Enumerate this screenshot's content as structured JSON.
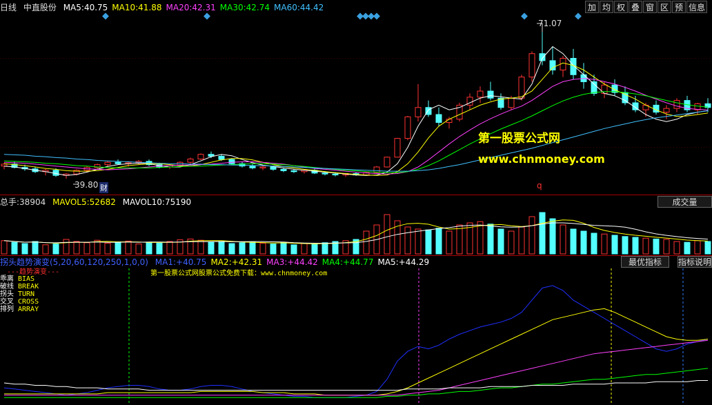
{
  "header": {
    "period": "日线",
    "stock": "中直股份",
    "ma": [
      {
        "label": "MA5:",
        "value": "40.75",
        "color": "#ffffff"
      },
      {
        "label": "MA10:",
        "value": "41.88",
        "color": "#ffff00"
      },
      {
        "label": "MA20:",
        "value": "42.31",
        "color": "#ff40ff"
      },
      {
        "label": "MA30:",
        "value": "42.74",
        "color": "#00ff00"
      },
      {
        "label": "MA60:",
        "value": "44.42",
        "color": "#40c0ff"
      }
    ]
  },
  "toolbar": [
    "加",
    "均",
    "权",
    "叠",
    "窗",
    "区",
    "预",
    "信息"
  ],
  "annotations": {
    "high": "71.07",
    "low": "39.80",
    "cai": "财",
    "q": "q"
  },
  "watermark": {
    "line1": "第一股票公式网",
    "line2": "www.chnmoney.com"
  },
  "volume_header": {
    "total_label": "总手:",
    "total_value": "38904",
    "mavol5_label": "MAVOL5:",
    "mavol5_value": "52682",
    "mavol10_label": "MAVOL10:",
    "mavol10_value": "75190",
    "button": "成交量"
  },
  "indicator_header": {
    "name": "拐头趋势演变(5,20,60,120,250,1,0,0)",
    "items": [
      {
        "label": "MA1:",
        "value": "+40.75",
        "color": "#4060ff"
      },
      {
        "label": "MA2:",
        "value": "+42.31",
        "color": "#ffff00"
      },
      {
        "label": "MA3:",
        "value": "+44.42",
        "color": "#ff40ff"
      },
      {
        "label": "MA4:",
        "value": "+44.77",
        "color": "#00ff00"
      },
      {
        "label": "MA5:",
        "value": "+44.29",
        "color": "#ffffff"
      }
    ],
    "btn_best": "最优指标",
    "btn_help": "指标说明"
  },
  "indicator_legend": {
    "title": "---趋势演变---",
    "rows": [
      {
        "cn": "乖离",
        "en": "BIAS"
      },
      {
        "cn": "破线",
        "en": "BREAK"
      },
      {
        "cn": "拐头",
        "en": "TURN"
      },
      {
        "cn": "交叉",
        "en": "CROSS"
      },
      {
        "cn": "排列",
        "en": "ARRAY"
      }
    ],
    "note": "第一股票公式网股票公式免费下载：www.chnmoney.com"
  },
  "chart_data": {
    "type": "line",
    "price": {
      "ylim": [
        37,
        75
      ],
      "ma5": [
        42.5,
        42.3,
        42.0,
        41.6,
        41.3,
        40.9,
        40.5,
        40.7,
        41.2,
        41.8,
        42.4,
        42.8,
        43.0,
        43.1,
        43.0,
        42.6,
        42.3,
        42.3,
        42.8,
        43.6,
        44.5,
        45.0,
        44.7,
        43.9,
        43.2,
        42.7,
        42.4,
        42.1,
        41.8,
        41.6,
        41.4,
        41.2,
        41.0,
        40.8,
        40.6,
        40.5,
        40.6,
        41.2,
        43.0,
        46.5,
        51.0,
        54.5,
        55.5,
        54.5,
        55.0,
        56.0,
        57.0,
        57.5,
        57.3,
        57.0,
        56.8,
        60.0,
        65.5,
        68.0,
        66.5,
        64.0,
        62.0,
        60.0,
        58.0,
        57.5,
        56.5,
        55.0,
        53.5,
        52.5,
        52.0,
        52.5,
        53.5,
        54.0,
        54.3
      ],
      "ma10": [
        43.0,
        42.8,
        42.6,
        42.3,
        42.0,
        41.8,
        41.5,
        41.4,
        41.4,
        41.5,
        41.8,
        42.2,
        42.6,
        42.8,
        43.0,
        43.0,
        42.8,
        42.6,
        42.5,
        42.8,
        43.3,
        43.8,
        44.1,
        44.1,
        43.8,
        43.3,
        42.8,
        42.4,
        42.1,
        41.8,
        41.6,
        41.3,
        41.1,
        40.9,
        40.7,
        40.6,
        40.5,
        40.6,
        41.3,
        43.0,
        45.5,
        48.5,
        51.0,
        52.5,
        53.5,
        54.5,
        55.5,
        56.2,
        56.8,
        57.0,
        57.3,
        58.5,
        61.0,
        63.5,
        64.5,
        64.0,
        63.0,
        61.5,
        60.0,
        58.8,
        57.8,
        56.8,
        55.5,
        54.5,
        53.6,
        53.1,
        53.2,
        53.5,
        53.8
      ],
      "ma20": [
        43.3,
        43.2,
        43.1,
        42.9,
        42.7,
        42.5,
        42.3,
        42.1,
        41.9,
        41.8,
        41.7,
        41.8,
        41.9,
        42.1,
        42.3,
        42.5,
        42.6,
        42.7,
        42.7,
        42.8,
        42.9,
        43.1,
        43.3,
        43.4,
        43.4,
        43.3,
        43.1,
        42.9,
        42.6,
        42.3,
        42.0,
        41.8,
        41.6,
        41.4,
        41.2,
        41.0,
        40.9,
        40.8,
        40.9,
        41.3,
        42.3,
        43.8,
        45.5,
        47.2,
        48.8,
        50.2,
        51.5,
        52.6,
        53.6,
        54.5,
        55.3,
        56.5,
        58.0,
        59.5,
        60.5,
        61.0,
        61.2,
        61.0,
        60.5,
        60.0,
        59.3,
        58.5,
        57.6,
        56.8,
        56.0,
        55.3,
        54.8,
        54.6,
        54.5
      ],
      "ma30": [
        43.6,
        43.5,
        43.4,
        43.3,
        43.1,
        43.0,
        42.8,
        42.6,
        42.5,
        42.3,
        42.2,
        42.1,
        42.1,
        42.1,
        42.1,
        42.2,
        42.3,
        42.4,
        42.5,
        42.5,
        42.6,
        42.7,
        42.8,
        42.9,
        43.0,
        43.0,
        42.9,
        42.8,
        42.6,
        42.4,
        42.2,
        42.0,
        41.8,
        41.6,
        41.5,
        41.3,
        41.2,
        41.1,
        41.1,
        41.3,
        41.8,
        42.6,
        43.6,
        44.8,
        46.0,
        47.2,
        48.3,
        49.4,
        50.4,
        51.3,
        52.2,
        53.2,
        54.3,
        55.4,
        56.4,
        57.2,
        57.8,
        58.2,
        58.4,
        58.4,
        58.2,
        57.9,
        57.5,
        57.0,
        56.5,
        56.0,
        55.6,
        55.3,
        55.1
      ],
      "ma60": [
        45.0,
        44.9,
        44.8,
        44.6,
        44.5,
        44.3,
        44.2,
        44.0,
        43.9,
        43.7,
        43.6,
        43.5,
        43.4,
        43.3,
        43.2,
        43.1,
        43.0,
        43.0,
        42.9,
        42.9,
        42.8,
        42.8,
        42.7,
        42.7,
        42.6,
        42.6,
        42.5,
        42.4,
        42.3,
        42.2,
        42.1,
        42.0,
        41.9,
        41.8,
        41.7,
        41.6,
        41.5,
        41.4,
        41.4,
        41.4,
        41.5,
        41.7,
        42.0,
        42.4,
        42.8,
        43.3,
        43.8,
        44.3,
        44.8,
        45.3,
        45.8,
        46.3,
        46.9,
        47.5,
        48.1,
        48.7,
        49.3,
        49.9,
        50.5,
        51.0,
        51.5,
        52.0,
        52.4,
        52.8,
        53.1,
        53.4,
        53.7,
        54.0,
        54.3
      ]
    },
    "candles": [
      [
        42.5,
        43.2,
        41.8,
        42.9
      ],
      [
        42.9,
        43.5,
        42.0,
        42.2
      ],
      [
        42.2,
        42.8,
        41.5,
        41.9
      ],
      [
        41.9,
        42.4,
        41.0,
        41.3
      ],
      [
        41.3,
        41.9,
        40.5,
        41.6
      ],
      [
        41.6,
        42.0,
        40.2,
        40.5
      ],
      [
        40.5,
        41.0,
        39.8,
        40.8
      ],
      [
        40.8,
        41.8,
        40.5,
        41.6
      ],
      [
        41.6,
        42.5,
        41.2,
        42.2
      ],
      [
        42.2,
        43.0,
        41.8,
        42.8
      ],
      [
        42.8,
        43.6,
        42.5,
        43.3
      ],
      [
        43.3,
        43.9,
        42.8,
        43.0
      ],
      [
        43.0,
        43.5,
        42.4,
        43.2
      ],
      [
        43.2,
        43.8,
        42.9,
        43.5
      ],
      [
        43.5,
        43.9,
        42.5,
        42.8
      ],
      [
        42.8,
        43.2,
        42.0,
        42.3
      ],
      [
        42.3,
        42.9,
        41.9,
        42.6
      ],
      [
        42.6,
        43.5,
        42.3,
        43.3
      ],
      [
        43.3,
        44.3,
        43.0,
        44.0
      ],
      [
        44.0,
        45.2,
        43.8,
        45.0
      ],
      [
        45.0,
        45.6,
        44.2,
        44.6
      ],
      [
        44.6,
        45.0,
        43.6,
        43.9
      ],
      [
        43.9,
        44.2,
        42.8,
        43.0
      ],
      [
        43.0,
        43.4,
        42.2,
        42.5
      ],
      [
        42.5,
        42.9,
        41.8,
        42.1
      ],
      [
        42.1,
        42.6,
        41.6,
        42.3
      ],
      [
        42.3,
        42.6,
        41.5,
        41.8
      ],
      [
        41.8,
        42.2,
        41.2,
        41.5
      ],
      [
        41.5,
        41.9,
        41.0,
        41.3
      ],
      [
        41.3,
        41.8,
        40.9,
        41.6
      ],
      [
        41.6,
        41.9,
        40.8,
        41.0
      ],
      [
        41.0,
        41.4,
        40.5,
        40.8
      ],
      [
        40.8,
        41.2,
        40.3,
        40.6
      ],
      [
        40.6,
        41.0,
        40.2,
        40.9
      ],
      [
        40.9,
        41.2,
        40.4,
        40.6
      ],
      [
        40.6,
        41.3,
        40.4,
        41.1
      ],
      [
        41.1,
        42.5,
        41.0,
        42.3
      ],
      [
        42.3,
        44.5,
        42.2,
        44.4
      ],
      [
        44.4,
        48.5,
        44.3,
        48.4
      ],
      [
        48.4,
        53.2,
        48.0,
        53.0
      ],
      [
        53.0,
        60.0,
        52.0,
        55.0
      ],
      [
        55.0,
        56.5,
        53.0,
        53.5
      ],
      [
        53.5,
        55.0,
        51.0,
        51.8
      ],
      [
        51.8,
        53.0,
        50.5,
        52.5
      ],
      [
        52.5,
        56.0,
        52.0,
        55.5
      ],
      [
        55.5,
        58.0,
        54.5,
        57.2
      ],
      [
        57.2,
        59.5,
        56.0,
        58.5
      ],
      [
        58.5,
        60.5,
        56.5,
        57.0
      ],
      [
        57.0,
        58.0,
        54.5,
        55.0
      ],
      [
        55.0,
        57.5,
        54.5,
        57.0
      ],
      [
        57.0,
        62.0,
        56.5,
        61.5
      ],
      [
        61.5,
        67.0,
        60.5,
        66.5
      ],
      [
        66.5,
        71.07,
        64.0,
        65.0
      ],
      [
        65.0,
        68.0,
        62.0,
        63.0
      ],
      [
        63.0,
        66.0,
        61.5,
        65.5
      ],
      [
        65.5,
        67.5,
        61.0,
        62.0
      ],
      [
        62.0,
        64.5,
        59.0,
        60.5
      ],
      [
        60.5,
        62.0,
        57.5,
        58.0
      ],
      [
        58.0,
        60.5,
        57.0,
        59.8
      ],
      [
        59.8,
        61.0,
        57.5,
        58.2
      ],
      [
        58.2,
        59.5,
        55.5,
        56.0
      ],
      [
        56.0,
        57.5,
        54.0,
        54.5
      ],
      [
        54.5,
        56.0,
        53.0,
        55.5
      ],
      [
        55.5,
        56.5,
        53.5,
        54.0
      ],
      [
        54.0,
        55.5,
        52.5,
        54.8
      ],
      [
        54.8,
        57.0,
        54.0,
        56.5
      ],
      [
        56.5,
        57.5,
        54.0,
        54.5
      ],
      [
        54.5,
        56.0,
        53.5,
        55.8
      ],
      [
        55.8,
        57.0,
        54.0,
        55.0
      ]
    ],
    "volume": [
      32,
      28,
      25,
      30,
      22,
      24,
      35,
      30,
      27,
      33,
      26,
      29,
      31,
      24,
      28,
      26,
      30,
      34,
      36,
      33,
      28,
      30,
      25,
      27,
      29,
      26,
      24,
      28,
      22,
      25,
      23,
      27,
      30,
      32,
      35,
      55,
      70,
      95,
      80,
      65,
      60,
      58,
      62,
      55,
      70,
      75,
      78,
      72,
      60,
      55,
      65,
      90,
      100,
      85,
      70,
      60,
      55,
      50,
      48,
      45,
      42,
      40,
      38,
      36,
      35,
      30,
      28,
      32,
      30
    ],
    "vol_ylim": [
      0,
      110
    ],
    "indicator": {
      "ylim": [
        -5,
        105
      ],
      "ma1": [
        8,
        7,
        6,
        5,
        4,
        3,
        2,
        3,
        4,
        6,
        8,
        9,
        10,
        10,
        9,
        7,
        6,
        6,
        7,
        9,
        10,
        10,
        9,
        7,
        5,
        4,
        3,
        2,
        1,
        1,
        0,
        0,
        0,
        0,
        1,
        2,
        5,
        15,
        30,
        38,
        42,
        40,
        43,
        48,
        52,
        55,
        58,
        60,
        62,
        65,
        70,
        80,
        90,
        92,
        88,
        80,
        75,
        70,
        65,
        60,
        55,
        50,
        45,
        40,
        38,
        40,
        44,
        46,
        48
      ],
      "ma2": [
        3,
        3,
        3,
        3,
        3,
        3,
        3,
        3,
        3,
        3,
        4,
        4,
        4,
        4,
        4,
        4,
        4,
        4,
        4,
        5,
        5,
        5,
        5,
        5,
        5,
        4,
        4,
        4,
        3,
        3,
        3,
        2,
        2,
        2,
        2,
        2,
        2,
        3,
        5,
        8,
        12,
        16,
        20,
        24,
        28,
        32,
        36,
        40,
        44,
        48,
        52,
        56,
        60,
        64,
        66,
        68,
        70,
        72,
        73,
        70,
        66,
        62,
        58,
        54,
        50,
        48,
        47,
        47,
        48
      ],
      "ma3": [
        2,
        2,
        2,
        2,
        2,
        2,
        2,
        2,
        2,
        2,
        2,
        2,
        2,
        2,
        2,
        2,
        2,
        2,
        2,
        2,
        2,
        2,
        2,
        2,
        2,
        2,
        2,
        2,
        2,
        2,
        2,
        2,
        2,
        2,
        2,
        2,
        2,
        2,
        2,
        3,
        4,
        5,
        6,
        8,
        10,
        12,
        14,
        16,
        18,
        20,
        22,
        24,
        26,
        28,
        30,
        32,
        34,
        36,
        37,
        38,
        39,
        40,
        41,
        42,
        43,
        44,
        45,
        46,
        47
      ],
      "ma4": [
        0,
        0,
        0,
        0,
        0,
        0,
        0,
        0,
        0,
        0,
        0,
        0,
        0,
        0,
        0,
        0,
        0,
        0,
        0,
        0,
        0,
        0,
        0,
        0,
        0,
        0,
        0,
        0,
        0,
        0,
        0,
        0,
        0,
        0,
        0,
        0,
        0,
        1,
        1,
        2,
        2,
        3,
        3,
        4,
        5,
        5,
        6,
        7,
        8,
        8,
        9,
        10,
        11,
        11,
        12,
        13,
        14,
        15,
        15,
        16,
        17,
        18,
        19,
        19,
        20,
        21,
        22,
        23,
        24
      ],
      "ma5": [
        12,
        11,
        11,
        10,
        10,
        9,
        9,
        8,
        8,
        8,
        7,
        7,
        7,
        7,
        6,
        6,
        6,
        6,
        6,
        6,
        6,
        6,
        6,
        6,
        6,
        6,
        6,
        6,
        6,
        6,
        6,
        6,
        6,
        6,
        6,
        6,
        6,
        6,
        6,
        7,
        7,
        7,
        7,
        8,
        8,
        8,
        8,
        9,
        9,
        9,
        9,
        10,
        10,
        10,
        10,
        11,
        11,
        11,
        11,
        12,
        12,
        12,
        12,
        13,
        13,
        13,
        13,
        14,
        14
      ]
    }
  }
}
